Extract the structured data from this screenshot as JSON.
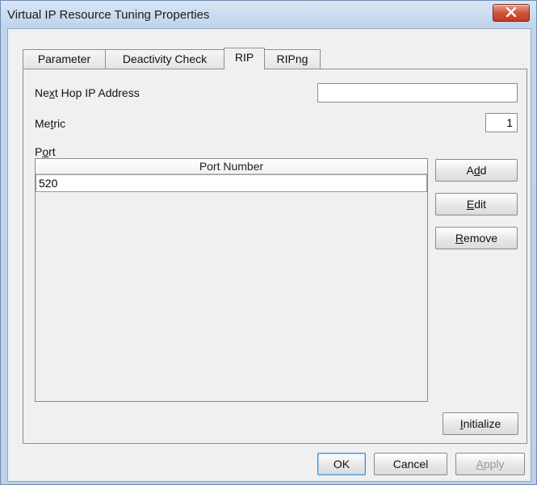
{
  "window": {
    "title": "Virtual IP Resource Tuning Properties",
    "close_icon": "close-icon"
  },
  "tabs": [
    {
      "label": "Parameter",
      "active": false
    },
    {
      "label": "Deactivity Check",
      "active": false
    },
    {
      "label": "RIP",
      "active": true
    },
    {
      "label": "RIPng",
      "active": false
    }
  ],
  "rip": {
    "next_hop": {
      "label_pre": "Ne",
      "label_mnemonic": "x",
      "label_post": "t Hop IP Address",
      "value": ""
    },
    "metric": {
      "label_pre": "Me",
      "label_mnemonic": "t",
      "label_post": "ric",
      "value": "1"
    },
    "port": {
      "label_pre": "P",
      "label_mnemonic": "o",
      "label_post": "rt"
    },
    "table": {
      "header": "Port Number",
      "rows": [
        "520"
      ]
    },
    "buttons": {
      "add": {
        "pre": "A",
        "mnemonic": "d",
        "post": "d"
      },
      "edit": {
        "pre": "",
        "mnemonic": "E",
        "post": "dit"
      },
      "remove": {
        "pre": "",
        "mnemonic": "R",
        "post": "emove"
      },
      "initialize": {
        "pre": "",
        "mnemonic": "I",
        "post": "nitialize"
      }
    }
  },
  "footer": {
    "ok": "OK",
    "cancel": "Cancel",
    "apply": {
      "pre": "",
      "mnemonic": "A",
      "post": "pply"
    }
  },
  "colors": {
    "close_button": "#c23a22",
    "panel_bg": "#f0f0f0",
    "title_bg": "#c2d5ec"
  }
}
